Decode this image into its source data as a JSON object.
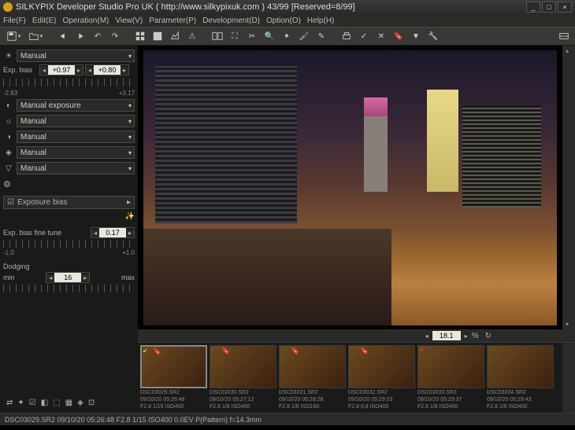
{
  "title": "SILKYPIX Developer Studio Pro UK ( http://www.silkypixuk.com )   43/99 [Reserved=8/99]",
  "menu": [
    "File(F)",
    "Edit(E)",
    "Operation(M)",
    "View(V)",
    "Parameter(P)",
    "Development(D)",
    "Option(O)",
    "Help(H)"
  ],
  "sidebar": {
    "preset": "Manual",
    "exp_bias_label": "Exp. bias",
    "exp_bias_val1": "+0.97",
    "exp_bias_val2": "+0.80",
    "slider_min": "-2.83",
    "slider_max": "+3.17",
    "params": [
      "Manual exposure",
      "Manual",
      "Manual",
      "Manual",
      "Manual"
    ],
    "section": "Exposure bias",
    "fine_label": "Exp. bias fine tune",
    "fine_val": "0.17",
    "fine_min": "-1.0",
    "fine_max": "+1.0",
    "dodge_label": "Dodging",
    "dodge_min_label": "min",
    "dodge_max_label": "max",
    "dodge_val": "16"
  },
  "zoom": {
    "value": "18.1",
    "pct": "%"
  },
  "thumbs": [
    {
      "file": "DSC03029.SR2",
      "date": "09/10/20 05:26:48",
      "meta": "F2.8 1/15 ISO400",
      "mark": "check",
      "tag": "blue"
    },
    {
      "file": "DSC03030.SR2",
      "date": "09/10/20 05:27:12",
      "meta": "F2.8 1/8 ISO400",
      "tag": "orange"
    },
    {
      "file": "DSC03031.SR2",
      "date": "09/10/20 05:28:28",
      "meta": "F2.8 1/8 ISO160",
      "tag": "green"
    },
    {
      "file": "DSC03032.SR2",
      "date": "09/10/20 05:29:23",
      "meta": "F2.8 0,8 ISO400",
      "tag": "red"
    },
    {
      "file": "DSC03033.SR2",
      "date": "09/10/20 05:29:37",
      "meta": "F2.8 1/8 ISO400",
      "mark": "x"
    },
    {
      "file": "DSC03034.SR2",
      "date": "09/10/20 05:29:43",
      "meta": "F2.8 1/8 ISO400"
    }
  ],
  "status": "DSC03029.SR2 09/10/20 05:26:48 F2.8 1/15 ISO400  0.0EV P(Pattern) f=14.3mm"
}
